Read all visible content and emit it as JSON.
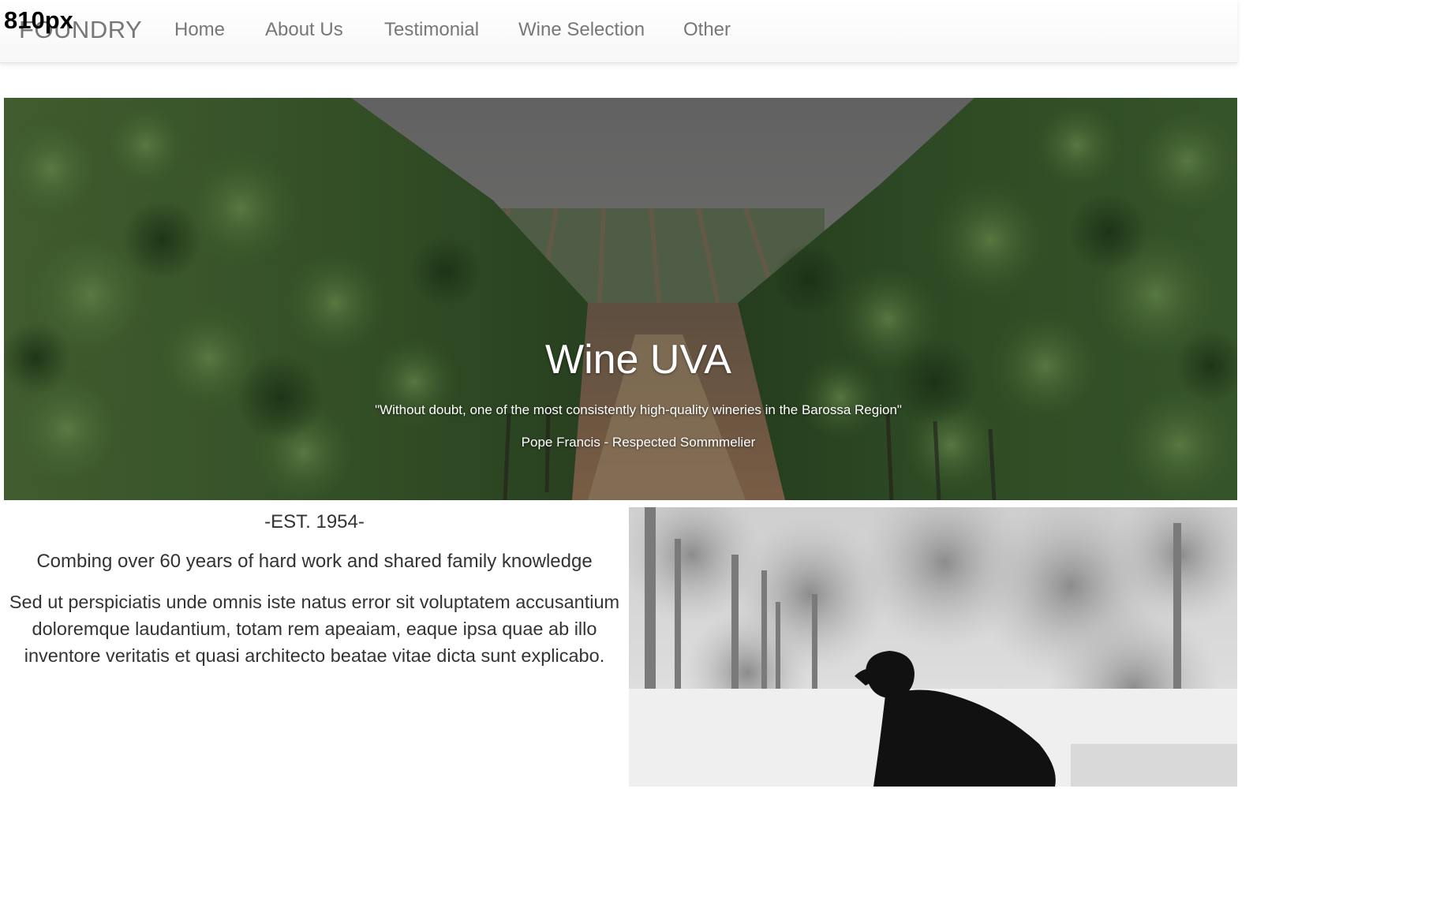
{
  "overlay": {
    "width_label": "810px"
  },
  "nav": {
    "brand": "FOUNDRY",
    "items": [
      {
        "label": "Home"
      },
      {
        "label": "About Us"
      },
      {
        "label": "Testimonial"
      },
      {
        "label": "Wine Selection"
      },
      {
        "label": "Other"
      }
    ]
  },
  "hero": {
    "title": "Wine UVA",
    "quote": "\"Without doubt, one of the most consistently high-quality wineries in the Barossa Region\"",
    "author": "Pope Francis - Respected Sommmelier"
  },
  "about": {
    "established": "-EST. 1954-",
    "lead": "Combing over 60 years of hard work and shared family knowledge",
    "body_lines": [
      "Sed ut perspiciatis unde omnis iste natus error sit voluptatem accusantium",
      "doloremque laudantium, totam rem apeaiam, eaque ipsa quae ab illo",
      "inventore veritatis et quasi architecto beatae vitae dicta sunt explicabo."
    ]
  }
}
